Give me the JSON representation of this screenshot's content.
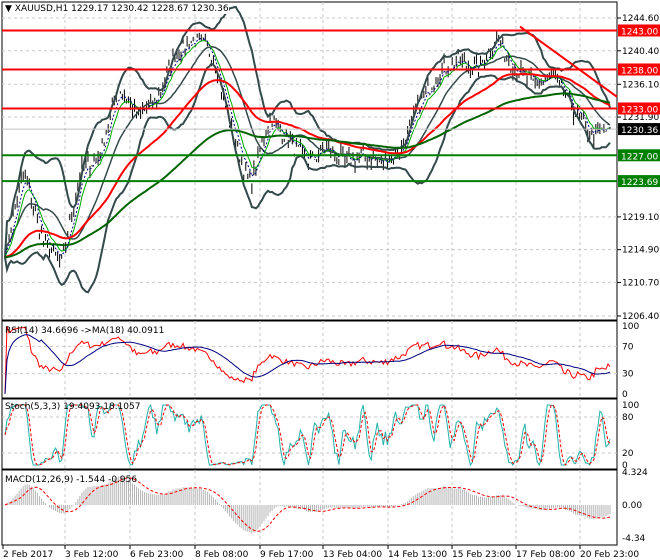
{
  "header": {
    "symbol": "XAUUSD,H1",
    "ohlc": "1229.17 1230.42 1228.67 1230.36"
  },
  "chart_data": [
    {
      "type": "line",
      "title": "XAUUSD,H1",
      "ylim": [
        1206.4,
        1244.6
      ],
      "yticks": [
        "1244.60",
        "1240.40",
        "1236.10",
        "1231.90",
        "1219.10",
        "1214.90",
        "1210.70",
        "1206.40"
      ],
      "key_closes": [
        1215,
        1225,
        1216,
        1213,
        1225,
        1227,
        1236,
        1232,
        1234,
        1240,
        1242,
        1240,
        1230,
        1223,
        1232,
        1229,
        1226,
        1228,
        1226,
        1227,
        1226,
        1228,
        1234,
        1238,
        1239,
        1238,
        1242,
        1238,
        1236,
        1237,
        1233,
        1229.5,
        1230.36
      ],
      "levels": [
        {
          "value": 1243.0,
          "label": "1243.00",
          "color": "#ff0000"
        },
        {
          "value": 1238.0,
          "label": "1238.00",
          "color": "#ff0000"
        },
        {
          "value": 1233.0,
          "label": "1233.00",
          "color": "#ff0000"
        },
        {
          "value": 1227.0,
          "label": "1227.00",
          "color": "#008000"
        },
        {
          "value": 1223.69,
          "label": "1223.69",
          "color": "#008000"
        }
      ],
      "current_price": "1230.36",
      "trendline": {
        "from": 1243.5,
        "to": 1234.5,
        "color": "#ff0000"
      }
    },
    {
      "type": "line",
      "title": "RSI(14) 34.6696  ->MA(18) 40.0911",
      "yticks": [
        "100",
        "70",
        "30",
        "0"
      ],
      "ylim": [
        0,
        100
      ]
    },
    {
      "type": "line",
      "title": "Stoch(5,3,3) 19.4093 18.1057",
      "yticks": [
        "100",
        "80",
        "20",
        "0"
      ],
      "ylim": [
        0,
        100
      ]
    },
    {
      "type": "bar",
      "title": "MACD(12,26,9) -1.544 -0.956",
      "yticks": [
        "4.324",
        "0.00",
        "-4.34"
      ],
      "ylim": [
        -4.34,
        4.324
      ]
    }
  ],
  "xaxis": [
    "2 Feb 2017",
    "3 Feb 12:00",
    "6 Feb 23:00",
    "8 Feb 08:00",
    "9 Feb 17:00",
    "13 Feb 04:00",
    "14 Feb 13:00",
    "15 Feb 23:00",
    "17 Feb 08:00",
    "20 Feb 23:00"
  ]
}
